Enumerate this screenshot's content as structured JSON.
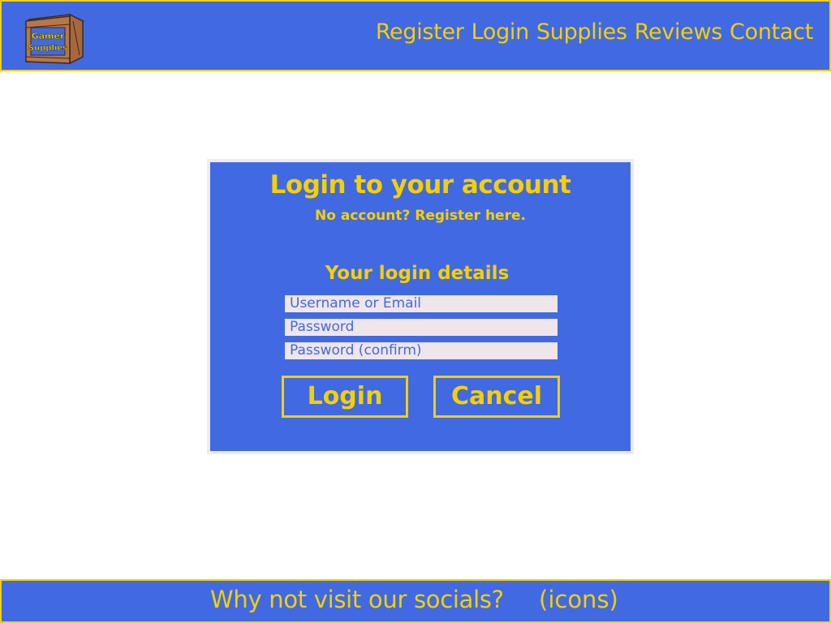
{
  "header": {
    "logo_text": "Gamer Supplies",
    "nav": [
      {
        "label": "Register"
      },
      {
        "label": "Login"
      },
      {
        "label": "Supplies"
      },
      {
        "label": "Reviews"
      },
      {
        "label": "Contact"
      }
    ]
  },
  "login": {
    "title": "Login to your account",
    "register_prompt": "No account? Register here.",
    "details_heading": "Your login details",
    "fields": {
      "username_placeholder": "Username or Email",
      "password_placeholder": "Password",
      "password_confirm_placeholder": "Password (confirm)"
    },
    "login_button": "Login",
    "cancel_button": "Cancel"
  },
  "footer": {
    "text": "Why not visit our socials?",
    "icons_label": "(icons)"
  },
  "colors": {
    "brand_blue": "#4169e1",
    "accent_yellow": "#f5d000",
    "field_bg": "#efe6ea"
  }
}
